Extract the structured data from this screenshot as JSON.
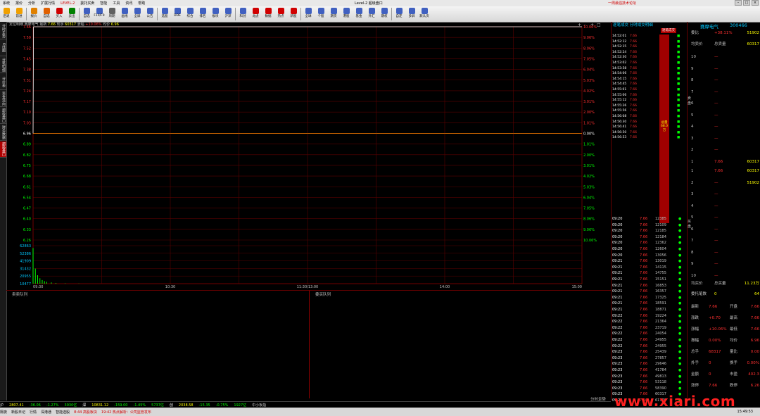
{
  "menu": {
    "items": [
      "系统",
      "报价",
      "分析",
      "扩展行情",
      "LEVEL-2",
      "委托买卖",
      "智能",
      "工具",
      "资讯",
      "帮助"
    ],
    "title": "Level-2 超级盘口",
    "right_note": "一周最强技术论坛"
  },
  "toolbar": {
    "buttons": [
      {
        "label": "后退",
        "icon": "back-arrow-icon",
        "color": "#f0a000"
      },
      {
        "label": "前进",
        "icon": "forward-arrow-icon",
        "color": "#f0a000"
      },
      {
        "label": "报价",
        "icon": "quote-icon",
        "color": "#e08000"
      },
      {
        "label": "自选",
        "icon": "favorite-icon",
        "color": "#e06000"
      },
      {
        "label": "买入",
        "icon": "buy-icon",
        "color": "#d00000"
      },
      {
        "label": "卖出",
        "icon": "sell-icon",
        "color": "#008000"
      },
      {
        "label": "自选",
        "icon": "list-icon",
        "color": "#4060c0"
      },
      {
        "label": "F10/F9",
        "icon": "f10-icon",
        "color": "#4060c0"
      },
      {
        "label": "周期",
        "icon": "period-icon",
        "color": "#606060"
      },
      {
        "label": "画线",
        "icon": "draw-icon",
        "color": "#4060c0"
      },
      {
        "label": "全屏",
        "icon": "fullscreen-icon",
        "color": "#4060c0"
      },
      {
        "label": "公告",
        "icon": "notice-icon",
        "color": "#4060c0"
      },
      {
        "label": "选股",
        "icon": "select-icon",
        "color": "#4060c0"
      },
      {
        "label": "DDE",
        "icon": "dde-icon",
        "color": "#4060c0"
      },
      {
        "label": "综合",
        "icon": "overview-icon",
        "color": "#4060c0"
      },
      {
        "label": "排名",
        "icon": "rank-icon",
        "color": "#4060c0"
      },
      {
        "label": "板块",
        "icon": "sector-icon",
        "color": "#4060c0"
      },
      {
        "label": "沪深",
        "icon": "market-icon",
        "color": "#4060c0"
      },
      {
        "label": "科创",
        "icon": "star-icon",
        "color": "#4060c0"
      },
      {
        "label": "龙虎",
        "icon": "dragon-icon",
        "color": "#d00000"
      },
      {
        "label": "数据",
        "icon": "data-icon",
        "color": "#d00000"
      },
      {
        "label": "热点",
        "icon": "hot-icon",
        "color": "#d00000"
      },
      {
        "label": "新股",
        "icon": "ipo-icon",
        "color": "#d00000"
      },
      {
        "label": "全球",
        "icon": "globe-icon",
        "color": "#4060c0"
      },
      {
        "label": "个股",
        "icon": "stock-icon",
        "color": "#4060c0"
      },
      {
        "label": "期货",
        "icon": "futures-icon",
        "color": "#4060c0"
      },
      {
        "label": "港股",
        "icon": "hk-icon",
        "color": "#4060c0"
      },
      {
        "label": "基金",
        "icon": "fund-icon",
        "color": "#4060c0"
      },
      {
        "label": "外汇",
        "icon": "forex-icon",
        "color": "#4060c0"
      },
      {
        "label": "期权",
        "icon": "option-icon",
        "color": "#4060c0"
      },
      {
        "label": "自定",
        "icon": "custom-icon",
        "color": "#4060c0"
      },
      {
        "label": "多屏",
        "icon": "multi-icon",
        "color": "#4060c0"
      },
      {
        "label": "默认页",
        "icon": "home-icon",
        "color": "#4060c0"
      }
    ]
  },
  "left_tabs": [
    "分时走势",
    "K线图",
    "分笔明细",
    "分价表",
    "资金流向",
    "超级盘口",
    "财务数据",
    "超级盘口"
  ],
  "info_line": {
    "prefix": "定位明细",
    "stock": "赛摩电气",
    "price_label": "最新",
    "price": "7.66",
    "vol_label": "现手",
    "vol": "60317",
    "change_label": "涨幅",
    "change": "+10.06%",
    "avg_label": "均价",
    "avg": "6.96"
  },
  "chart_data": {
    "type": "line",
    "title": "",
    "prev_close": 6.96,
    "y_left_labels": [
      "7.66",
      "7.59",
      "7.52",
      "7.45",
      "7.38",
      "7.31",
      "7.24",
      "7.17",
      "7.10",
      "7.03",
      "6.96",
      "6.89",
      "6.82",
      "6.75",
      "6.68",
      "6.61",
      "6.54",
      "6.47",
      "6.40",
      "6.33",
      "6.26"
    ],
    "y_right_labels": [
      "10.06%",
      "9.06%",
      "8.06%",
      "7.05%",
      "6.04%",
      "5.03%",
      "4.02%",
      "3.01%",
      "2.00%",
      "1.01%",
      "0.00%",
      "1.01%",
      "2.00%",
      "3.01%",
      "4.02%",
      "5.03%",
      "6.04%",
      "7.05%",
      "8.06%",
      "9.06%",
      "10.06%"
    ],
    "ylim": [
      6.26,
      7.66
    ],
    "vol_labels": [
      "62863",
      "52386",
      "41909",
      "31432",
      "20955",
      "10477"
    ],
    "x_labels": [
      "09:30",
      "10:30",
      "11:30/13:00",
      "14:00",
      "15:00"
    ],
    "price_points": [
      {
        "t": 0,
        "p": 6.96
      },
      {
        "t": 0.2,
        "p": 7.66
      },
      {
        "t": 240,
        "p": 7.66
      }
    ],
    "volume_points": [
      {
        "t": 0,
        "v": 59000
      },
      {
        "t": 1,
        "v": 25000
      },
      {
        "t": 2,
        "v": 14000
      },
      {
        "t": 3,
        "v": 9000
      },
      {
        "t": 4,
        "v": 6000
      },
      {
        "t": 5,
        "v": 4200
      },
      {
        "t": 6,
        "v": 3000
      },
      {
        "t": 8,
        "v": 2000
      },
      {
        "t": 10,
        "v": 1200
      },
      {
        "t": 14,
        "v": 600
      },
      {
        "t": 20,
        "v": 300
      },
      {
        "t": 60,
        "v": 200
      },
      {
        "t": 120,
        "v": 180
      },
      {
        "t": 180,
        "v": 150
      },
      {
        "t": 240,
        "v": 120
      }
    ],
    "grid": true,
    "legend": ""
  },
  "queues": {
    "sell_title": "卖卖队列",
    "buy_title": "委买队列",
    "right_label": "分时走势"
  },
  "ticks": {
    "title": "逐笔成交",
    "title2": "分时成交明细",
    "tab": "逐笔成交",
    "upper_rows": [
      "14:52:01",
      "14:52:12",
      "14:52:15",
      "14:52:24",
      "14:52:30",
      "14:53:02",
      "14:53:58",
      "14:54:06",
      "14:54:15",
      "14:54:45",
      "14:55:01",
      "14:55:06",
      "14:55:12",
      "14:55:26",
      "14:55:56",
      "14:56:08",
      "14:56:30",
      "14:56:41",
      "14:56:50",
      "14:56:53"
    ],
    "upper_price": "7.66",
    "bar_label": "总量",
    "bar_value": "68.0万",
    "rows": [
      {
        "t": "09:20",
        "p": "7.66",
        "v": "12385"
      },
      {
        "t": "09:20",
        "p": "7.66",
        "v": "12109"
      },
      {
        "t": "09:20",
        "p": "7.66",
        "v": "12185"
      },
      {
        "t": "09:20",
        "p": "7.66",
        "v": "12184"
      },
      {
        "t": "09:20",
        "p": "7.66",
        "v": "12362"
      },
      {
        "t": "09:20",
        "p": "7.66",
        "v": "12604"
      },
      {
        "t": "09:20",
        "p": "7.66",
        "v": "13056"
      },
      {
        "t": "09:21",
        "p": "7.66",
        "v": "13019"
      },
      {
        "t": "09:21",
        "p": "7.66",
        "v": "14115"
      },
      {
        "t": "09:21",
        "p": "7.66",
        "v": "14755"
      },
      {
        "t": "09:21",
        "p": "7.66",
        "v": "15151"
      },
      {
        "t": "09:21",
        "p": "7.66",
        "v": "16853"
      },
      {
        "t": "09:21",
        "p": "7.66",
        "v": "16357"
      },
      {
        "t": "09:21",
        "p": "7.66",
        "v": "17325"
      },
      {
        "t": "09:21",
        "p": "7.66",
        "v": "18591"
      },
      {
        "t": "09:21",
        "p": "7.66",
        "v": "18871"
      },
      {
        "t": "09:22",
        "p": "7.66",
        "v": "19224"
      },
      {
        "t": "09:22",
        "p": "7.66",
        "v": "21364"
      },
      {
        "t": "09:22",
        "p": "7.66",
        "v": "23719"
      },
      {
        "t": "09:22",
        "p": "7.66",
        "v": "24054"
      },
      {
        "t": "09:22",
        "p": "7.66",
        "v": "24955"
      },
      {
        "t": "09:22",
        "p": "7.66",
        "v": "24955"
      },
      {
        "t": "09:23",
        "p": "7.66",
        "v": "25439"
      },
      {
        "t": "09:23",
        "p": "7.66",
        "v": "27857"
      },
      {
        "t": "09:23",
        "p": "7.66",
        "v": "29646"
      },
      {
        "t": "09:23",
        "p": "7.66",
        "v": "41784"
      },
      {
        "t": "09:23",
        "p": "7.66",
        "v": "49813"
      },
      {
        "t": "09:23",
        "p": "7.66",
        "v": "53118"
      },
      {
        "t": "09:23",
        "p": "7.66",
        "v": "58390"
      },
      {
        "t": "09:23",
        "p": "7.66",
        "v": "60317"
      },
      {
        "t": "09:23",
        "p": "7.66",
        "v": "61779"
      }
    ]
  },
  "quote": {
    "name": "赛摩电气",
    "code": "300466",
    "weibi_label": "委比",
    "weibi": "+38.11%",
    "weicha": "51902",
    "avg_sell_label": "均卖价",
    "total_sell_label": "总卖量",
    "total_sell": "60317",
    "sell_side_label": "卖盘",
    "buy_side_label": "买盘",
    "sell_levels": [
      {
        "n": "10",
        "p": "—",
        "v": ""
      },
      {
        "n": "9",
        "p": "—",
        "v": ""
      },
      {
        "n": "8",
        "p": "—",
        "v": ""
      },
      {
        "n": "7",
        "p": "—",
        "v": ""
      },
      {
        "n": "6",
        "p": "—",
        "v": ""
      },
      {
        "n": "5",
        "p": "—",
        "v": ""
      },
      {
        "n": "4",
        "p": "—",
        "v": ""
      },
      {
        "n": "3",
        "p": "—",
        "v": ""
      },
      {
        "n": "2",
        "p": "—",
        "v": ""
      },
      {
        "n": "1",
        "p": "7.66",
        "v": "60317"
      }
    ],
    "buy_levels": [
      {
        "n": "1",
        "p": "7.66",
        "v": "60317"
      },
      {
        "n": "2",
        "p": "—",
        "v": "51902"
      },
      {
        "n": "3",
        "p": "—",
        "v": ""
      },
      {
        "n": "4",
        "p": "—",
        "v": ""
      },
      {
        "n": "5",
        "p": "—",
        "v": ""
      },
      {
        "n": "6",
        "p": "—",
        "v": ""
      },
      {
        "n": "7",
        "p": "—",
        "v": ""
      },
      {
        "n": "8",
        "p": "—",
        "v": ""
      },
      {
        "n": "9",
        "p": "—",
        "v": ""
      },
      {
        "n": "10",
        "p": "—",
        "v": ""
      }
    ],
    "avg_buy_label": "均买价",
    "total_buy_label": "总买量",
    "total_buy": "11.23万",
    "bishu_label": "委托笔数",
    "bishu": "0",
    "bishu2_label": "均笔量",
    "bishu2": "64",
    "stats": [
      {
        "l": "最新",
        "m": "7.66",
        "ml": "开盘",
        "r": "7.66"
      },
      {
        "l": "涨跌",
        "m": "+0.70",
        "ml": "最高",
        "r": "7.66"
      },
      {
        "l": "涨幅",
        "m": "+10.06%",
        "ml": "最低",
        "r": "7.66"
      },
      {
        "l": "振幅",
        "m": "0.00%",
        "ml": "均价",
        "r": "6.96"
      },
      {
        "l": "总手",
        "m": "68317",
        "ml": "量比",
        "r": "0.00"
      },
      {
        "l": "外手",
        "m": "0",
        "ml": "换手",
        "r": "0.00%"
      },
      {
        "l": "金额",
        "m": "0",
        "ml": "市盈",
        "r": "402.3"
      },
      {
        "l": "涨停",
        "m": "7.66",
        "ml": "跌停",
        "r": "6.26"
      }
    ]
  },
  "status_bar": {
    "items": [
      "沪",
      "2807.41",
      "-36.06",
      "-1.27%",
      "3930亿",
      "深",
      "10831.12",
      "-159.00",
      "-1.45%",
      "5737亿",
      "创",
      "2038.58",
      "-15.35",
      "-0.75%",
      "1927亿",
      "中小板指"
    ],
    "right_label": "分时走势"
  },
  "status_bar2": {
    "items": [
      "隔夜",
      "新股日记",
      "行情",
      "深港通",
      "智能选股",
      "8:44 高股板块",
      "19:42 热点解析：公司监管发布"
    ],
    "time": "15:49:53"
  },
  "watermark": "www.xiari.com"
}
